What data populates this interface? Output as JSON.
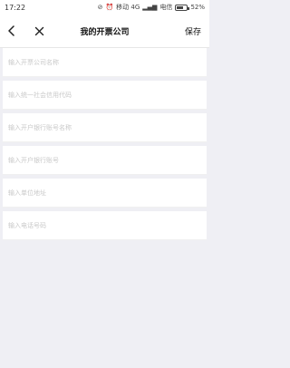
{
  "status_bar": {
    "time": "17:22",
    "carrier1": "移动 4G",
    "carrier2": "电信",
    "battery_text": "52%",
    "battery_level": 0.52
  },
  "nav": {
    "title": "我的开票公司",
    "save_label": "保存"
  },
  "form": {
    "fields": [
      {
        "placeholder": "输入开票公司名称",
        "value": ""
      },
      {
        "placeholder": "输入统一社会信用代码",
        "value": ""
      },
      {
        "placeholder": "输入开户银行账号名称",
        "value": ""
      },
      {
        "placeholder": "输入开户银行账号",
        "value": ""
      },
      {
        "placeholder": "输入单位地址",
        "value": ""
      },
      {
        "placeholder": "输入电话号码",
        "value": ""
      }
    ]
  }
}
